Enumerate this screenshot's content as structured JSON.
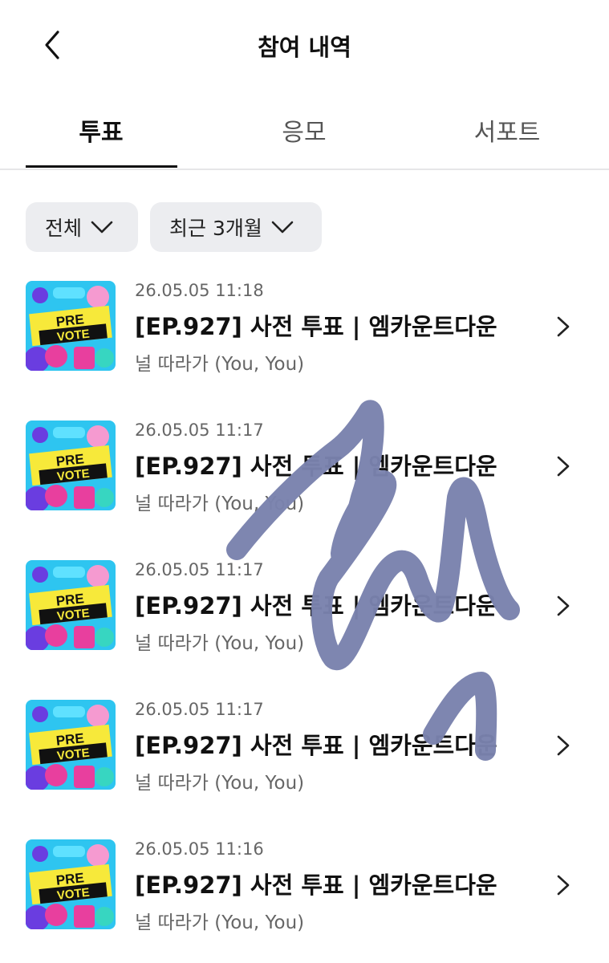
{
  "header": {
    "title": "참여 내역",
    "back_icon": "chevron-left-icon"
  },
  "tabs": [
    {
      "label": "투표",
      "active": true
    },
    {
      "label": "응모",
      "active": false
    },
    {
      "label": "서포트",
      "active": false
    }
  ],
  "filters": [
    {
      "label": "전체",
      "icon": "chevron-down-icon"
    },
    {
      "label": "최근 3개월",
      "icon": "chevron-down-icon"
    }
  ],
  "thumbnail": {
    "line1": "PRE",
    "line2": "VOTE",
    "colors": {
      "sky": "#2ec5f0",
      "magenta": "#e83f9e",
      "purple": "#6a3de0",
      "yellow": "#f7e93a",
      "black": "#111111"
    }
  },
  "items": [
    {
      "date": "26.05.05 11:18",
      "title": "[EP.927] 사전 투표 | 엠카운트다운",
      "subtitle": "널 따라가 (You, You)"
    },
    {
      "date": "26.05.05 11:17",
      "title": "[EP.927] 사전 투표 | 엠카운트다운",
      "subtitle": "널 따라가 (You, You)"
    },
    {
      "date": "26.05.05 11:17",
      "title": "[EP.927] 사전 투표 | 엠카운트다운",
      "subtitle": "널 따라가 (You, You)"
    },
    {
      "date": "26.05.05 11:17",
      "title": "[EP.927] 사전 투표 | 엠카운트다운",
      "subtitle": "널 따라가 (You, You)"
    },
    {
      "date": "26.05.05 11:16",
      "title": "[EP.927] 사전 투표 | 엠카운트다운",
      "subtitle": "널 따라가 (You, You)"
    }
  ],
  "colors": {
    "active_text": "#111111",
    "inactive_text": "#555555",
    "filter_bg": "#ecedf0",
    "meta_text": "#666666",
    "scribble": "#7a82ad"
  }
}
